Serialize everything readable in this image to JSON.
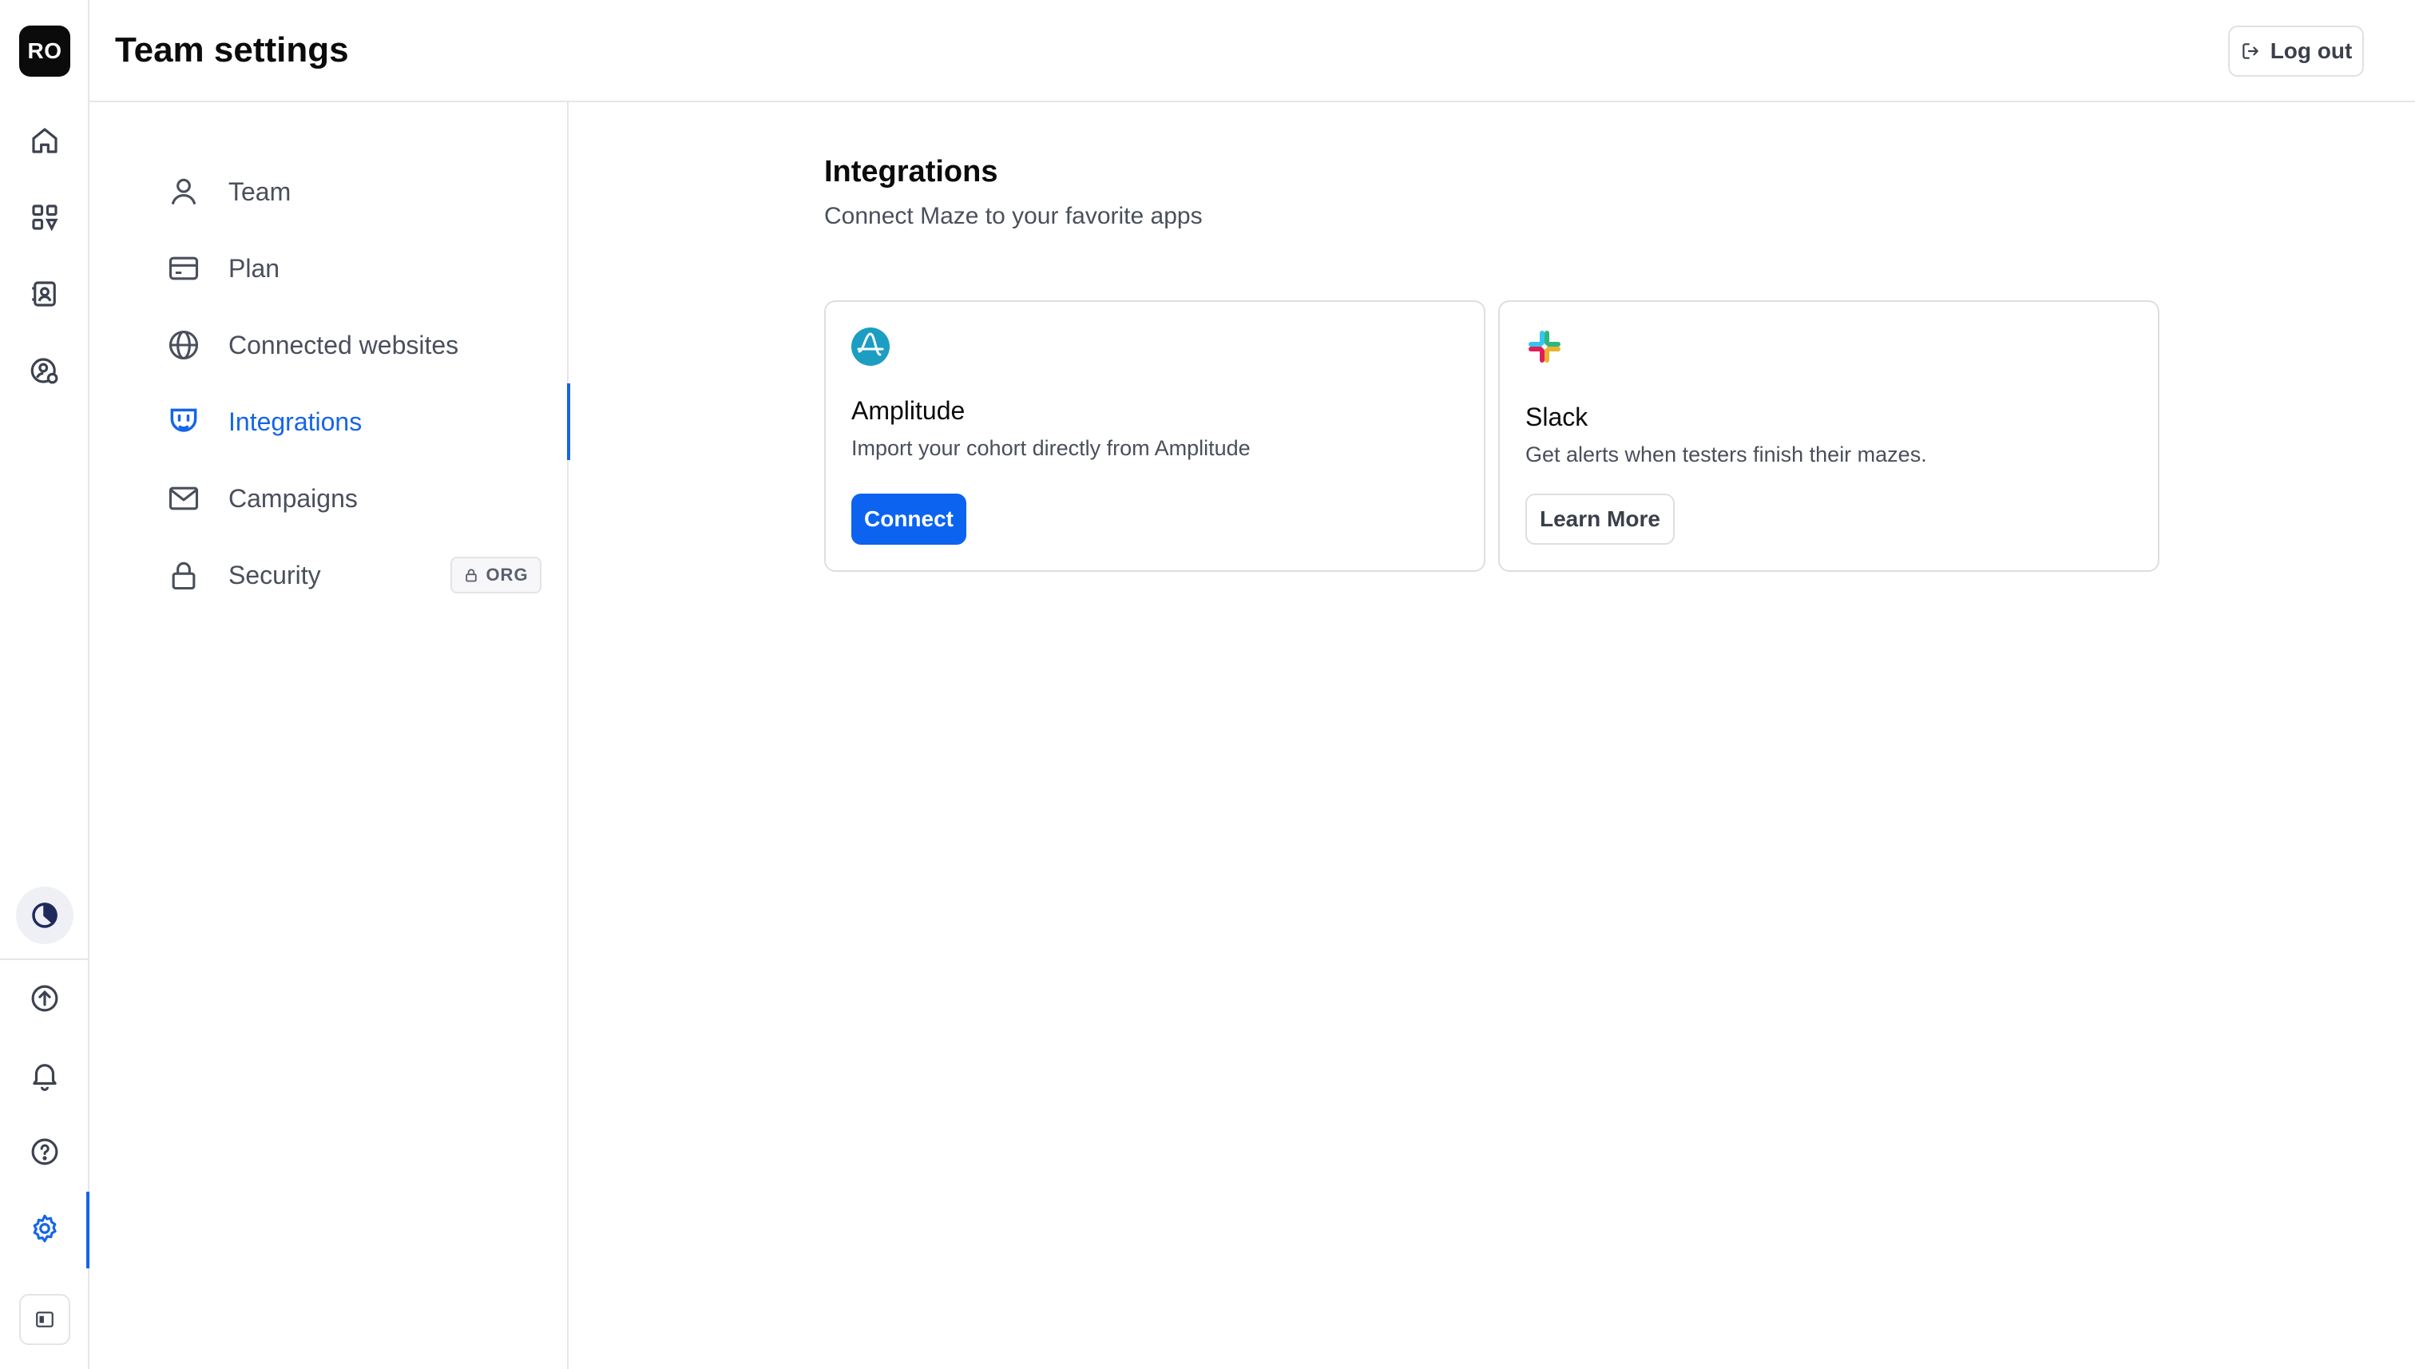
{
  "header": {
    "title": "Team settings",
    "logout_label": "Log out"
  },
  "rail": {
    "avatar_initials": "RO",
    "icons": [
      "home-icon",
      "dashboard-icon",
      "contacts-icon",
      "user-coin-icon",
      "progress-icon",
      "upload-icon",
      "bell-icon",
      "help-icon",
      "gear-icon",
      "sidebar-toggle-icon"
    ]
  },
  "subnav": {
    "items": [
      {
        "label": "Team",
        "icon": "user-icon"
      },
      {
        "label": "Plan",
        "icon": "credit-card-icon"
      },
      {
        "label": "Connected websites",
        "icon": "globe-icon"
      },
      {
        "label": "Integrations",
        "icon": "plug-icon",
        "active": true
      },
      {
        "label": "Campaigns",
        "icon": "mail-icon"
      },
      {
        "label": "Security",
        "icon": "lock-icon",
        "badge": "ORG"
      }
    ]
  },
  "main": {
    "title": "Integrations",
    "subtitle": "Connect Maze to your favorite apps",
    "cards": [
      {
        "name": "Amplitude",
        "description": "Import your cohort directly from Amplitude",
        "action": "Connect"
      },
      {
        "name": "Slack",
        "description": "Get alerts when testers finish their mazes.",
        "action": "Learn More"
      }
    ]
  },
  "colors": {
    "accent": "#1565e8",
    "primary_button": "#0b63f0",
    "amplitude": "#1b9ec2"
  }
}
